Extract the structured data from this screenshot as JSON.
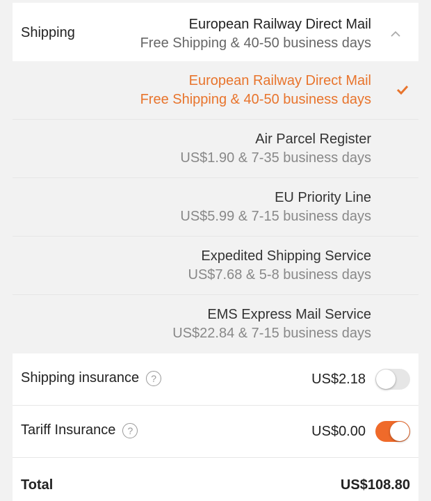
{
  "shipping": {
    "label": "Shipping",
    "selected_method": "European Railway Direct Mail",
    "selected_detail": "Free Shipping & 40-50 business days"
  },
  "options": [
    {
      "name": "European Railway Direct Mail",
      "detail": "Free Shipping & 40-50 business days",
      "selected": true
    },
    {
      "name": "Air Parcel Register",
      "detail": "US$1.90 & 7-35 business days",
      "selected": false
    },
    {
      "name": "EU Priority Line",
      "detail": "US$5.99 & 7-15 business days",
      "selected": false
    },
    {
      "name": "Expedited Shipping Service",
      "detail": "US$7.68 & 5-8 business days",
      "selected": false
    },
    {
      "name": "EMS Express Mail Service",
      "detail": "US$22.84 & 7-15 business days",
      "selected": false
    }
  ],
  "insurance": {
    "shipping_label": "Shipping insurance",
    "shipping_price": "US$2.18",
    "shipping_enabled": false,
    "tariff_label": "Tariff Insurance",
    "tariff_price": "US$0.00",
    "tariff_enabled": true,
    "help_glyph": "?"
  },
  "total": {
    "label": "Total",
    "value": "US$108.80"
  },
  "colors": {
    "accent": "#ef6a2a",
    "selected_text": "#e8742c"
  }
}
